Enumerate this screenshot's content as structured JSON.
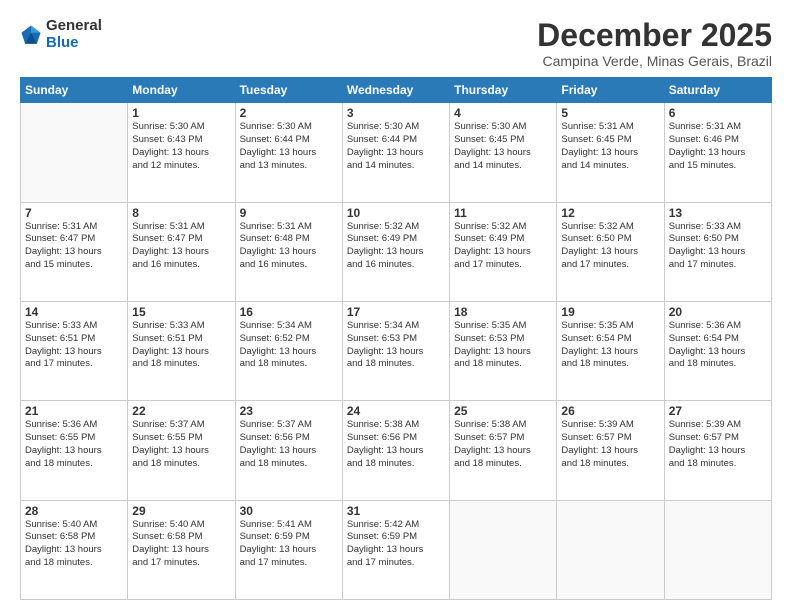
{
  "logo": {
    "general": "General",
    "blue": "Blue"
  },
  "header": {
    "month": "December 2025",
    "location": "Campina Verde, Minas Gerais, Brazil"
  },
  "weekdays": [
    "Sunday",
    "Monday",
    "Tuesday",
    "Wednesday",
    "Thursday",
    "Friday",
    "Saturday"
  ],
  "weeks": [
    [
      {
        "day": "",
        "info": ""
      },
      {
        "day": "1",
        "info": "Sunrise: 5:30 AM\nSunset: 6:43 PM\nDaylight: 13 hours\nand 12 minutes."
      },
      {
        "day": "2",
        "info": "Sunrise: 5:30 AM\nSunset: 6:44 PM\nDaylight: 13 hours\nand 13 minutes."
      },
      {
        "day": "3",
        "info": "Sunrise: 5:30 AM\nSunset: 6:44 PM\nDaylight: 13 hours\nand 14 minutes."
      },
      {
        "day": "4",
        "info": "Sunrise: 5:30 AM\nSunset: 6:45 PM\nDaylight: 13 hours\nand 14 minutes."
      },
      {
        "day": "5",
        "info": "Sunrise: 5:31 AM\nSunset: 6:45 PM\nDaylight: 13 hours\nand 14 minutes."
      },
      {
        "day": "6",
        "info": "Sunrise: 5:31 AM\nSunset: 6:46 PM\nDaylight: 13 hours\nand 15 minutes."
      }
    ],
    [
      {
        "day": "7",
        "info": "Sunrise: 5:31 AM\nSunset: 6:47 PM\nDaylight: 13 hours\nand 15 minutes."
      },
      {
        "day": "8",
        "info": "Sunrise: 5:31 AM\nSunset: 6:47 PM\nDaylight: 13 hours\nand 16 minutes."
      },
      {
        "day": "9",
        "info": "Sunrise: 5:31 AM\nSunset: 6:48 PM\nDaylight: 13 hours\nand 16 minutes."
      },
      {
        "day": "10",
        "info": "Sunrise: 5:32 AM\nSunset: 6:49 PM\nDaylight: 13 hours\nand 16 minutes."
      },
      {
        "day": "11",
        "info": "Sunrise: 5:32 AM\nSunset: 6:49 PM\nDaylight: 13 hours\nand 17 minutes."
      },
      {
        "day": "12",
        "info": "Sunrise: 5:32 AM\nSunset: 6:50 PM\nDaylight: 13 hours\nand 17 minutes."
      },
      {
        "day": "13",
        "info": "Sunrise: 5:33 AM\nSunset: 6:50 PM\nDaylight: 13 hours\nand 17 minutes."
      }
    ],
    [
      {
        "day": "14",
        "info": "Sunrise: 5:33 AM\nSunset: 6:51 PM\nDaylight: 13 hours\nand 17 minutes."
      },
      {
        "day": "15",
        "info": "Sunrise: 5:33 AM\nSunset: 6:51 PM\nDaylight: 13 hours\nand 18 minutes."
      },
      {
        "day": "16",
        "info": "Sunrise: 5:34 AM\nSunset: 6:52 PM\nDaylight: 13 hours\nand 18 minutes."
      },
      {
        "day": "17",
        "info": "Sunrise: 5:34 AM\nSunset: 6:53 PM\nDaylight: 13 hours\nand 18 minutes."
      },
      {
        "day": "18",
        "info": "Sunrise: 5:35 AM\nSunset: 6:53 PM\nDaylight: 13 hours\nand 18 minutes."
      },
      {
        "day": "19",
        "info": "Sunrise: 5:35 AM\nSunset: 6:54 PM\nDaylight: 13 hours\nand 18 minutes."
      },
      {
        "day": "20",
        "info": "Sunrise: 5:36 AM\nSunset: 6:54 PM\nDaylight: 13 hours\nand 18 minutes."
      }
    ],
    [
      {
        "day": "21",
        "info": "Sunrise: 5:36 AM\nSunset: 6:55 PM\nDaylight: 13 hours\nand 18 minutes."
      },
      {
        "day": "22",
        "info": "Sunrise: 5:37 AM\nSunset: 6:55 PM\nDaylight: 13 hours\nand 18 minutes."
      },
      {
        "day": "23",
        "info": "Sunrise: 5:37 AM\nSunset: 6:56 PM\nDaylight: 13 hours\nand 18 minutes."
      },
      {
        "day": "24",
        "info": "Sunrise: 5:38 AM\nSunset: 6:56 PM\nDaylight: 13 hours\nand 18 minutes."
      },
      {
        "day": "25",
        "info": "Sunrise: 5:38 AM\nSunset: 6:57 PM\nDaylight: 13 hours\nand 18 minutes."
      },
      {
        "day": "26",
        "info": "Sunrise: 5:39 AM\nSunset: 6:57 PM\nDaylight: 13 hours\nand 18 minutes."
      },
      {
        "day": "27",
        "info": "Sunrise: 5:39 AM\nSunset: 6:57 PM\nDaylight: 13 hours\nand 18 minutes."
      }
    ],
    [
      {
        "day": "28",
        "info": "Sunrise: 5:40 AM\nSunset: 6:58 PM\nDaylight: 13 hours\nand 18 minutes."
      },
      {
        "day": "29",
        "info": "Sunrise: 5:40 AM\nSunset: 6:58 PM\nDaylight: 13 hours\nand 17 minutes."
      },
      {
        "day": "30",
        "info": "Sunrise: 5:41 AM\nSunset: 6:59 PM\nDaylight: 13 hours\nand 17 minutes."
      },
      {
        "day": "31",
        "info": "Sunrise: 5:42 AM\nSunset: 6:59 PM\nDaylight: 13 hours\nand 17 minutes."
      },
      {
        "day": "",
        "info": ""
      },
      {
        "day": "",
        "info": ""
      },
      {
        "day": "",
        "info": ""
      }
    ]
  ]
}
